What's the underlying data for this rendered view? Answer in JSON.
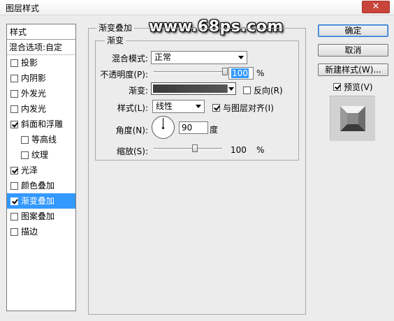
{
  "dialog": {
    "title": "图层样式",
    "close_glyph": "✕"
  },
  "watermark": "www.68ps.com",
  "style_list": {
    "header": "样式",
    "blend_options": "混合选项:自定",
    "items": [
      {
        "label": "投影",
        "checked": false,
        "indent": false,
        "selected": false
      },
      {
        "label": "内阴影",
        "checked": false,
        "indent": false,
        "selected": false
      },
      {
        "label": "外发光",
        "checked": false,
        "indent": false,
        "selected": false
      },
      {
        "label": "内发光",
        "checked": false,
        "indent": false,
        "selected": false
      },
      {
        "label": "斜面和浮雕",
        "checked": true,
        "indent": false,
        "selected": false
      },
      {
        "label": "等高线",
        "checked": false,
        "indent": true,
        "selected": false
      },
      {
        "label": "纹理",
        "checked": false,
        "indent": true,
        "selected": false
      },
      {
        "label": "光泽",
        "checked": true,
        "indent": false,
        "selected": false
      },
      {
        "label": "颜色叠加",
        "checked": false,
        "indent": false,
        "selected": false
      },
      {
        "label": "渐变叠加",
        "checked": true,
        "indent": false,
        "selected": true
      },
      {
        "label": "图案叠加",
        "checked": false,
        "indent": false,
        "selected": false
      },
      {
        "label": "描边",
        "checked": false,
        "indent": false,
        "selected": false
      }
    ]
  },
  "buttons": {
    "ok": "确定",
    "cancel": "取消",
    "new_style": "新建样式(W)..."
  },
  "preview": {
    "label": "预览(V)",
    "checked": true
  },
  "panel": {
    "outer_title": "渐变叠加",
    "inner_title": "渐变",
    "blend_mode_label": "混合模式:",
    "blend_mode_value": "正常",
    "opacity_label": "不透明度(P):",
    "opacity_value": "100",
    "opacity_unit": "%",
    "gradient_label": "渐变:",
    "reverse_label": "反向(R)",
    "reverse_checked": false,
    "style_label": "样式(L):",
    "style_value": "线性",
    "align_label": "与图层对齐(I)",
    "align_checked": true,
    "angle_label": "角度(N):",
    "angle_value": "90",
    "angle_unit": "度",
    "scale_label": "缩放(S):",
    "scale_value": "100",
    "scale_unit": "%",
    "opacity_fraction": 1.0,
    "scale_fraction": 0.6
  }
}
